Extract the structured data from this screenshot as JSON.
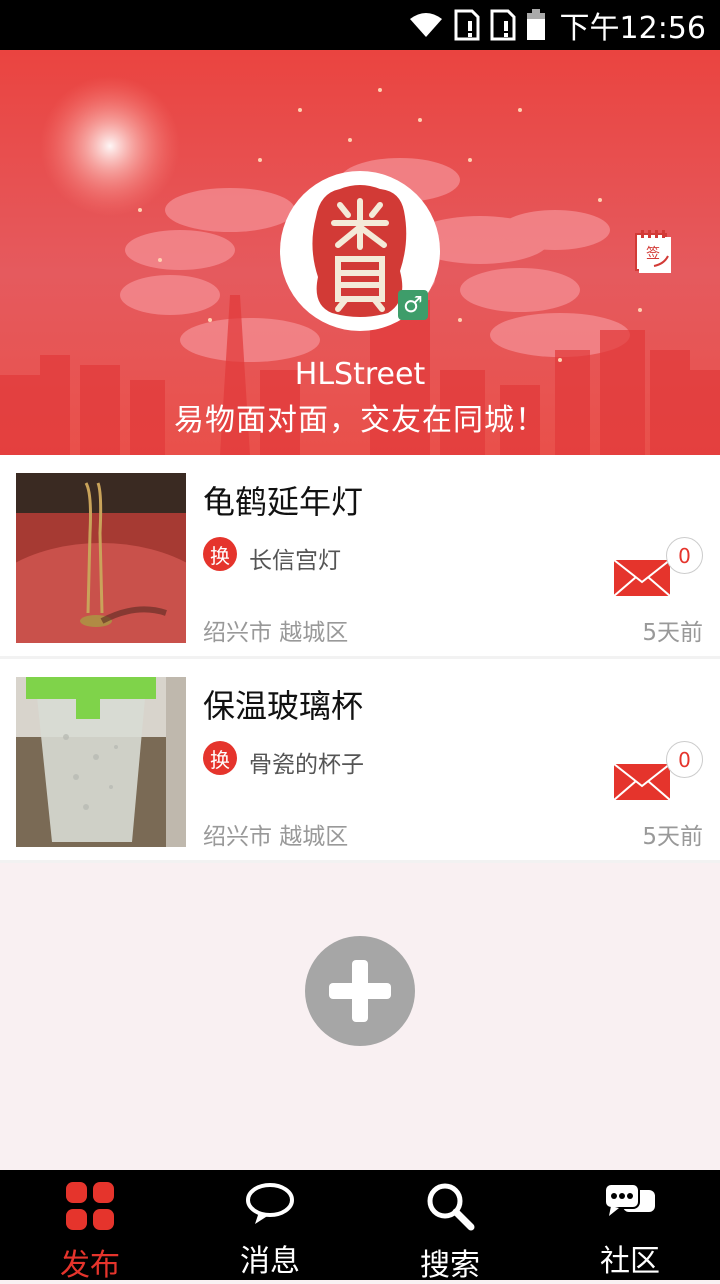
{
  "status_bar": {
    "time": "下午12:56"
  },
  "profile": {
    "username": "HLStreet",
    "slogan": "易物面对面，交友在同城！",
    "gender_symbol": "♂",
    "sign_label": "签"
  },
  "items": [
    {
      "title": "龟鹤延年灯",
      "swap_badge": "换",
      "swap_text": "长信宫灯",
      "location": "绍兴市 越城区",
      "time_ago": "5天前",
      "message_count": "0"
    },
    {
      "title": "保温玻璃杯",
      "swap_badge": "换",
      "swap_text": "骨瓷的杯子",
      "location": "绍兴市 越城区",
      "time_ago": "5天前",
      "message_count": "0"
    }
  ],
  "tabs": [
    {
      "label": "发布",
      "icon": "grid-icon",
      "active": true
    },
    {
      "label": "消息",
      "icon": "chat-bubble-icon",
      "active": false
    },
    {
      "label": "搜索",
      "icon": "search-icon",
      "active": false
    },
    {
      "label": "社区",
      "icon": "community-icon",
      "active": false
    }
  ],
  "colors": {
    "accent": "#e5342c",
    "hero_red": "#ea4440",
    "gender_green": "#3e9d6a"
  }
}
